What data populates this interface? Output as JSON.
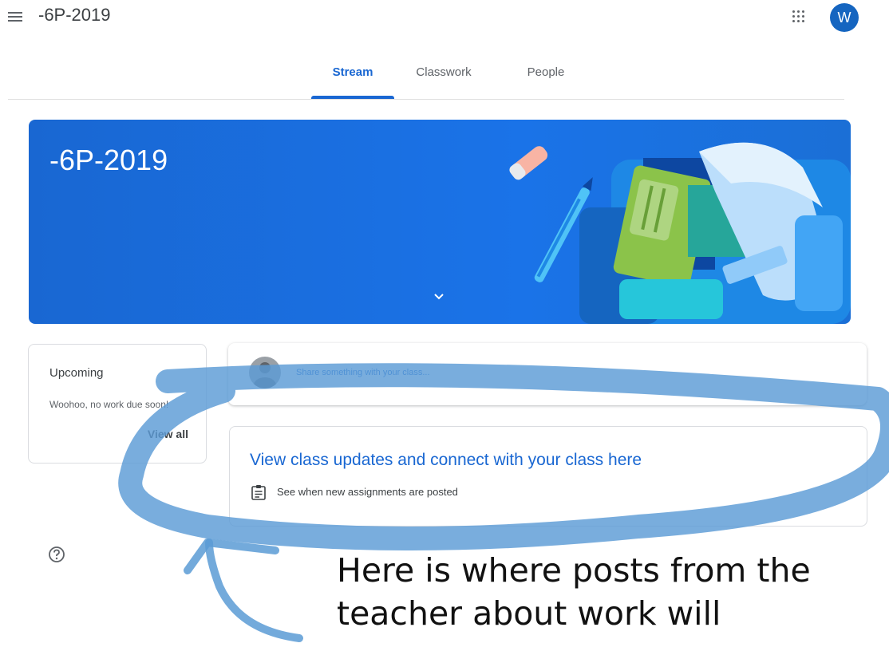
{
  "header": {
    "class_name": "-6P-2019",
    "avatar_letter": "W"
  },
  "tabs": [
    {
      "label": "Stream",
      "active": true
    },
    {
      "label": "Classwork",
      "active": false
    },
    {
      "label": "People",
      "active": false
    }
  ],
  "banner": {
    "title": "-6P-2019",
    "color": "#1a73e8"
  },
  "upcoming": {
    "title": "Upcoming",
    "empty_text": "Woohoo, no work due soon!",
    "view_all": "View all"
  },
  "share": {
    "placeholder": "Share something with your class..."
  },
  "updates": {
    "title": "View class updates and connect with your class here",
    "subtitle": "See when new assignments are posted"
  },
  "annotation": {
    "text": "Here is where posts from the teacher about work will",
    "stroke_color": "#5b9bd5"
  },
  "icons": [
    "menu-icon",
    "apps-icon",
    "chevron-down-icon",
    "assignment-icon",
    "help-icon"
  ]
}
